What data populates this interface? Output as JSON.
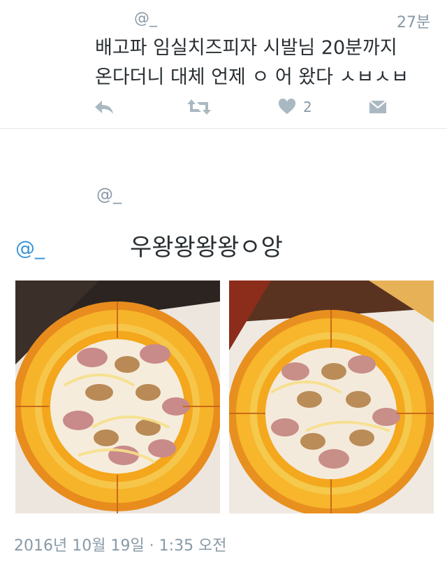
{
  "tweet": {
    "handle": "@_",
    "time": "27분",
    "lines": [
      "배고파 임실치즈피자 시발님 20분까지",
      "온다더니 대체 언제 ㅇ 어 왔다 ㅅㅂㅅㅂ"
    ],
    "like_count": "2",
    "icons": [
      "reply-icon",
      "retweet-icon",
      "heart-icon",
      "dm-icon"
    ]
  },
  "quoted": {
    "handle_gray": "@_",
    "handle_blue": "@_",
    "text": "우왕왕왕왕ㅇ앙"
  },
  "photos": [
    "pizza-photo-1",
    "pizza-photo-2"
  ],
  "footer": {
    "date": "2016년 10월 19일 · 1:35 오전"
  },
  "colors": {
    "text": "#292f33",
    "muted": "#8899a6",
    "link": "#3b94d9",
    "icon": "#aab8c2"
  }
}
